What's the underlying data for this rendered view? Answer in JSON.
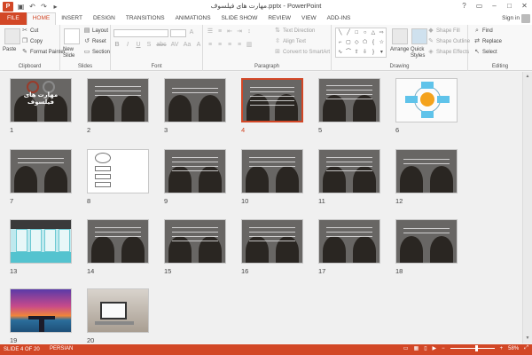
{
  "window": {
    "title": "مهارت های فیلسوف.pptx - PowerPoint",
    "controls": [
      "?",
      "▭",
      "–",
      "□",
      "✕"
    ]
  },
  "qat": {
    "logo": "P",
    "icons": [
      "save-icon",
      "undo-icon",
      "redo-icon",
      "start-icon"
    ]
  },
  "tabs": [
    "FILE",
    "HOME",
    "INSERT",
    "DESIGN",
    "TRANSITIONS",
    "ANIMATIONS",
    "SLIDE SHOW",
    "REVIEW",
    "VIEW",
    "ADD-INS"
  ],
  "active_tab": "HOME",
  "account": {
    "signin": "Sign in"
  },
  "ribbon": {
    "clipboard": {
      "label": "Clipboard",
      "paste": "Paste",
      "cut": "Cut",
      "copy": "Copy",
      "format_painter": "Format Painter"
    },
    "slides": {
      "label": "Slides",
      "new_slide": "New Slide",
      "layout": "Layout",
      "reset": "Reset",
      "section": "Section"
    },
    "font": {
      "label": "Font",
      "format_buttons": [
        "B",
        "I",
        "U",
        "S",
        "abc",
        "AV",
        "Aa",
        "A"
      ]
    },
    "paragraph": {
      "label": "Paragraph",
      "text_direction": "Text Direction",
      "align_text": "Align Text",
      "convert_smartart": "Convert to SmartArt"
    },
    "drawing": {
      "label": "Drawing",
      "arrange": "Arrange",
      "quick_styles": "Quick Styles",
      "shape_fill": "Shape Fill",
      "shape_outline": "Shape Outline",
      "shape_effects": "Shape Effects"
    },
    "editing": {
      "label": "Editing",
      "find": "Find",
      "replace": "Replace",
      "select": "Select"
    }
  },
  "slides": [
    {
      "num": "1",
      "kind": "title",
      "title_text": "مهارت های فیلسوف"
    },
    {
      "num": "2",
      "kind": "text"
    },
    {
      "num": "3",
      "kind": "text"
    },
    {
      "num": "4",
      "kind": "text",
      "selected": true
    },
    {
      "num": "5",
      "kind": "text"
    },
    {
      "num": "6",
      "kind": "diagram"
    },
    {
      "num": "7",
      "kind": "text"
    },
    {
      "num": "8",
      "kind": "flow"
    },
    {
      "num": "9",
      "kind": "text"
    },
    {
      "num": "10",
      "kind": "text"
    },
    {
      "num": "11",
      "kind": "text"
    },
    {
      "num": "12",
      "kind": "text"
    },
    {
      "num": "13",
      "kind": "table"
    },
    {
      "num": "14",
      "kind": "text"
    },
    {
      "num": "15",
      "kind": "text"
    },
    {
      "num": "16",
      "kind": "text"
    },
    {
      "num": "17",
      "kind": "text"
    },
    {
      "num": "18",
      "kind": "text"
    },
    {
      "num": "19",
      "kind": "sunset"
    },
    {
      "num": "20",
      "kind": "laptop"
    }
  ],
  "status": {
    "slide": "SLIDE 4 OF 20",
    "language": "PERSIAN",
    "zoom": "58%"
  }
}
